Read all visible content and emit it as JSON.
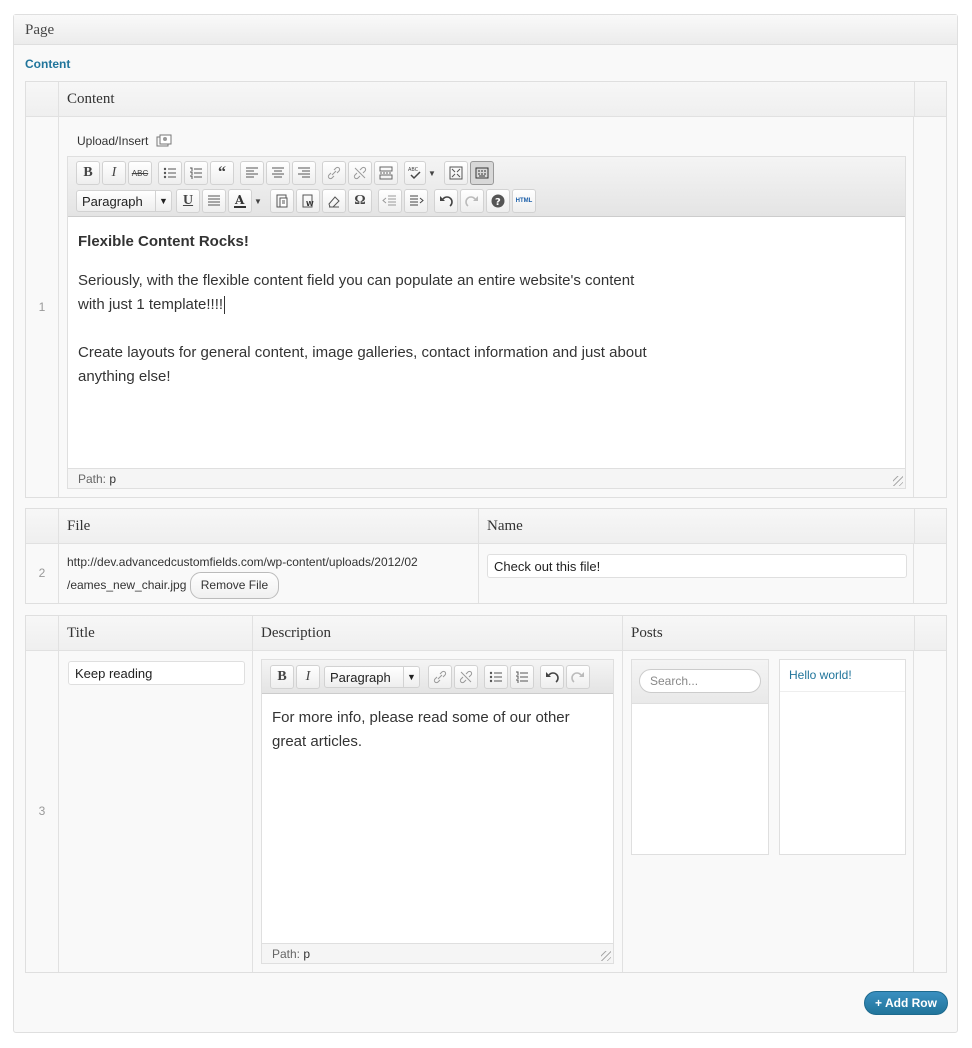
{
  "postbox": {
    "title": "Page"
  },
  "field": {
    "label": "Content"
  },
  "layout1": {
    "number": "1",
    "header": "Content",
    "upload_label": "Upload/Insert",
    "toolbar": {
      "format": "Paragraph"
    },
    "content": {
      "heading": "Flexible Content Rocks!",
      "para1_line1": "Seriously, with the flexible content field you can populate an entire website's content",
      "para1_line2": "with just 1 template!!!!",
      "para2_line1": "Create layouts for general content, image galleries, contact information and just about",
      "para2_line2": "anything else!"
    },
    "path_label": "Path:",
    "path_value": "p"
  },
  "layout2": {
    "number": "2",
    "header_file": "File",
    "header_name": "Name",
    "file_url_line1": "http://dev.advancedcustomfields.com/wp-content/uploads/2012/02",
    "file_url_line2": "/eames_new_chair.jpg",
    "remove_label": "Remove File",
    "name_value": "Check out this file!"
  },
  "layout3": {
    "number": "3",
    "header_title": "Title",
    "header_description": "Description",
    "header_posts": "Posts",
    "title_value": "Keep reading",
    "toolbar": {
      "format": "Paragraph"
    },
    "content": {
      "line1": "For more info, please read some of our other",
      "line2": "great articles."
    },
    "path_label": "Path:",
    "path_value": "p",
    "search_placeholder": "Search...",
    "selected_posts": [
      "Hello world!"
    ]
  },
  "actions": {
    "add_row": "+ Add Row"
  },
  "colors": {
    "accent": "#21759b",
    "border": "#dfdfdf"
  }
}
